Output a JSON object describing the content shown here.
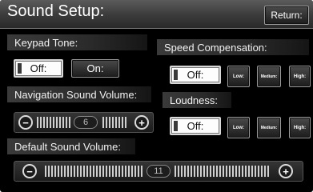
{
  "header": {
    "title": "Sound Setup:",
    "return_label": "Return:"
  },
  "keypad_tone": {
    "label": "Keypad Tone:",
    "options": [
      {
        "label": "Off:",
        "selected": true
      },
      {
        "label": "On:",
        "selected": false
      }
    ]
  },
  "speed_compensation": {
    "label": "Speed Compensation:",
    "options": [
      {
        "label": "Off:",
        "selected": true
      },
      {
        "label": "Low:",
        "selected": false
      },
      {
        "label": "Medium:",
        "selected": false
      },
      {
        "label": "High:",
        "selected": false
      }
    ]
  },
  "navigation_volume": {
    "label": "Navigation Sound Volume:",
    "value": "6"
  },
  "loudness": {
    "label": "Loudness:",
    "options": [
      {
        "label": "Off:",
        "selected": true
      },
      {
        "label": "Low:",
        "selected": false
      },
      {
        "label": "Medium:",
        "selected": false
      },
      {
        "label": "High:",
        "selected": false
      }
    ]
  },
  "default_volume": {
    "label": "Default Sound Volume:",
    "value": "11"
  },
  "icons": {
    "decrease": "minus-circle-icon",
    "increase": "plus-circle-icon"
  }
}
